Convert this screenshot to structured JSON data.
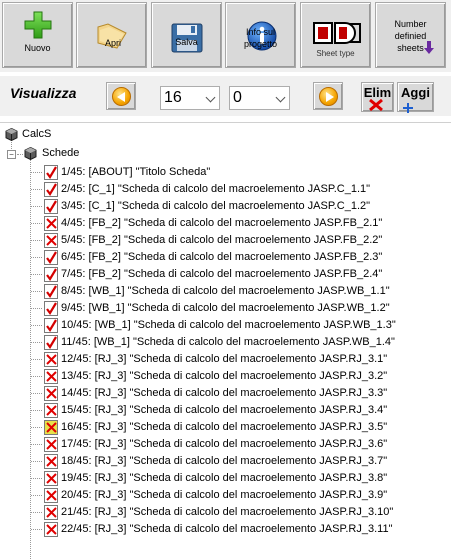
{
  "toolbar": {
    "buttons": [
      {
        "id": "nuovo",
        "label": "Nuovo",
        "icon": "green-plus-icon"
      },
      {
        "id": "apri",
        "label": "Apri",
        "icon": "open-folder-icon"
      },
      {
        "id": "salva",
        "label": "Salva",
        "icon": "floppy-disk-icon"
      },
      {
        "id": "info",
        "label_line1": "Info sul",
        "label_line2": "progetto",
        "icon": "info-icon"
      },
      {
        "id": "sheettype",
        "label": "Sheet type",
        "icon": "sheet-type-icon"
      },
      {
        "id": "numbersheets",
        "label_line1": "Number",
        "label_line2": "definied",
        "label_line3": "sheets",
        "icon": "number-sheets-icon"
      }
    ]
  },
  "nav": {
    "visualizza_label": "Visualizza",
    "combo_sheets_value": "16",
    "combo_second_value": "0",
    "elim_label": "Elim",
    "aggi_label": "Aggi"
  },
  "tree": {
    "root_label": "CalcS",
    "schede_label": "Schede",
    "sheets": [
      {
        "text": "1/45: [ABOUT] \"Titolo Scheda\"",
        "status": "check"
      },
      {
        "text": "2/45: [C_1] \"Scheda di calcolo del macroelemento JASP.C_1.1\"",
        "status": "check"
      },
      {
        "text": "3/45: [C_1] \"Scheda di calcolo del macroelemento JASP.C_1.2\"",
        "status": "check"
      },
      {
        "text": "4/45: [FB_2] \"Scheda di calcolo del macroelemento JASP.FB_2.1\"",
        "status": "cross"
      },
      {
        "text": "5/45: [FB_2] \"Scheda di calcolo del macroelemento JASP.FB_2.2\"",
        "status": "cross"
      },
      {
        "text": "6/45: [FB_2] \"Scheda di calcolo del macroelemento JASP.FB_2.3\"",
        "status": "check"
      },
      {
        "text": "7/45: [FB_2] \"Scheda di calcolo del macroelemento JASP.FB_2.4\"",
        "status": "check"
      },
      {
        "text": "8/45: [WB_1] \"Scheda di calcolo del macroelemento JASP.WB_1.1\"",
        "status": "check"
      },
      {
        "text": "9/45: [WB_1] \"Scheda di calcolo del macroelemento JASP.WB_1.2\"",
        "status": "check"
      },
      {
        "text": "10/45: [WB_1] \"Scheda di calcolo del macroelemento JASP.WB_1.3\"",
        "status": "check"
      },
      {
        "text": "11/45: [WB_1] \"Scheda di calcolo del macroelemento JASP.WB_1.4\"",
        "status": "check"
      },
      {
        "text": "12/45: [RJ_3] \"Scheda di calcolo del macroelemento JASP.RJ_3.1\"",
        "status": "cross"
      },
      {
        "text": "13/45: [RJ_3] \"Scheda di calcolo del macroelemento JASP.RJ_3.2\"",
        "status": "cross"
      },
      {
        "text": "14/45: [RJ_3] \"Scheda di calcolo del macroelemento JASP.RJ_3.3\"",
        "status": "cross"
      },
      {
        "text": "15/45: [RJ_3] \"Scheda di calcolo del macroelemento JASP.RJ_3.4\"",
        "status": "cross"
      },
      {
        "text": "16/45: [RJ_3] \"Scheda di calcolo del macroelemento JASP.RJ_3.5\"",
        "status": "cross-selected"
      },
      {
        "text": "17/45: [RJ_3] \"Scheda di calcolo del macroelemento JASP.RJ_3.6\"",
        "status": "cross"
      },
      {
        "text": "18/45: [RJ_3] \"Scheda di calcolo del macroelemento JASP.RJ_3.7\"",
        "status": "cross"
      },
      {
        "text": "19/45: [RJ_3] \"Scheda di calcolo del macroelemento JASP.RJ_3.8\"",
        "status": "cross"
      },
      {
        "text": "20/45: [RJ_3] \"Scheda di calcolo del macroelemento JASP.RJ_3.9\"",
        "status": "cross"
      },
      {
        "text": "21/45: [RJ_3] \"Scheda di calcolo del macroelemento JASP.RJ_3.10\"",
        "status": "cross"
      },
      {
        "text": "22/45: [RJ_3] \"Scheda di calcolo del macroelemento JASP.RJ_3.11\"",
        "status": "cross"
      }
    ]
  },
  "colors": {
    "check_red": "#d40000",
    "cross_red": "#e00000",
    "selected_bg": "#e6e24a",
    "toolbar_bg": "#d9d9d9"
  }
}
